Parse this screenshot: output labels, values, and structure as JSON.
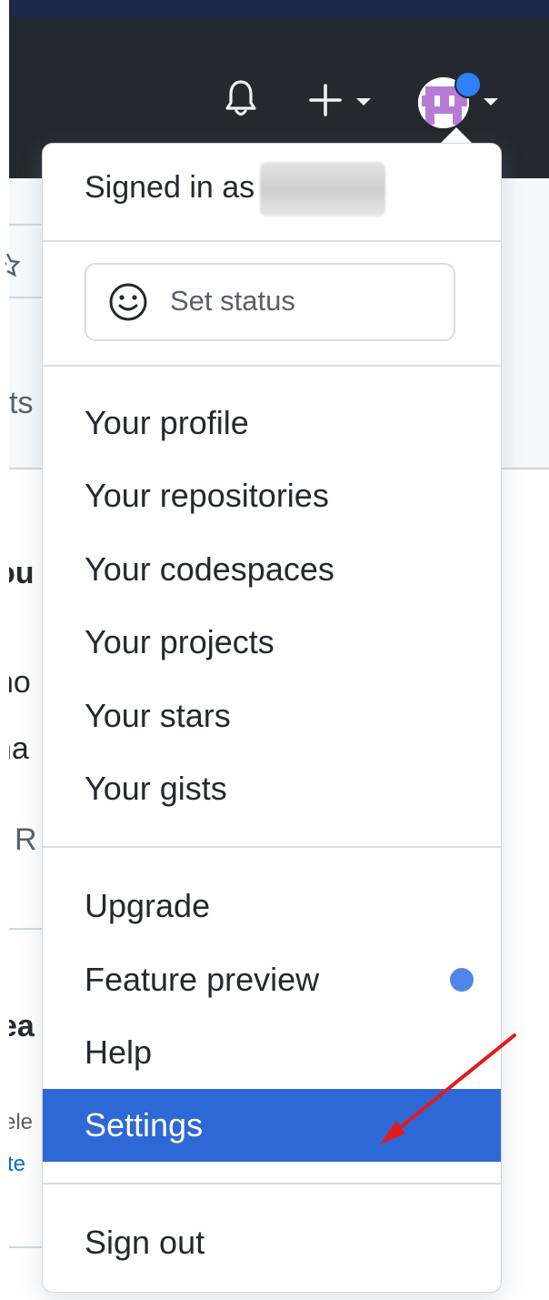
{
  "header": {
    "icons": [
      "bell-icon",
      "plus-icon",
      "chevron-down-icon",
      "avatar",
      "chevron-down-icon"
    ],
    "header_color": "#24292f"
  },
  "background_fragments": {
    "tab_suffix": "ts",
    "heading_a": "ou",
    "line_b": "ho",
    "line_c": "na",
    "line_d": "R",
    "heading_e": "ea",
    "text_f": "ele",
    "link_g": "te"
  },
  "menu": {
    "signed_in_label": "Signed in as",
    "set_status_label": "Set status",
    "group1": [
      {
        "label": "Your profile"
      },
      {
        "label": "Your repositories"
      },
      {
        "label": "Your codespaces"
      },
      {
        "label": "Your projects"
      },
      {
        "label": "Your stars"
      },
      {
        "label": "Your gists"
      }
    ],
    "group2": [
      {
        "label": "Upgrade"
      },
      {
        "label": "Feature preview"
      },
      {
        "label": "Help"
      },
      {
        "label": "Settings"
      }
    ],
    "sign_out_label": "Sign out",
    "highlighted_item": "Settings",
    "highlight_color": "#2e67d6",
    "annotation": "red-arrow-pointing-to-settings",
    "annotation_color": "#e21b1b"
  }
}
